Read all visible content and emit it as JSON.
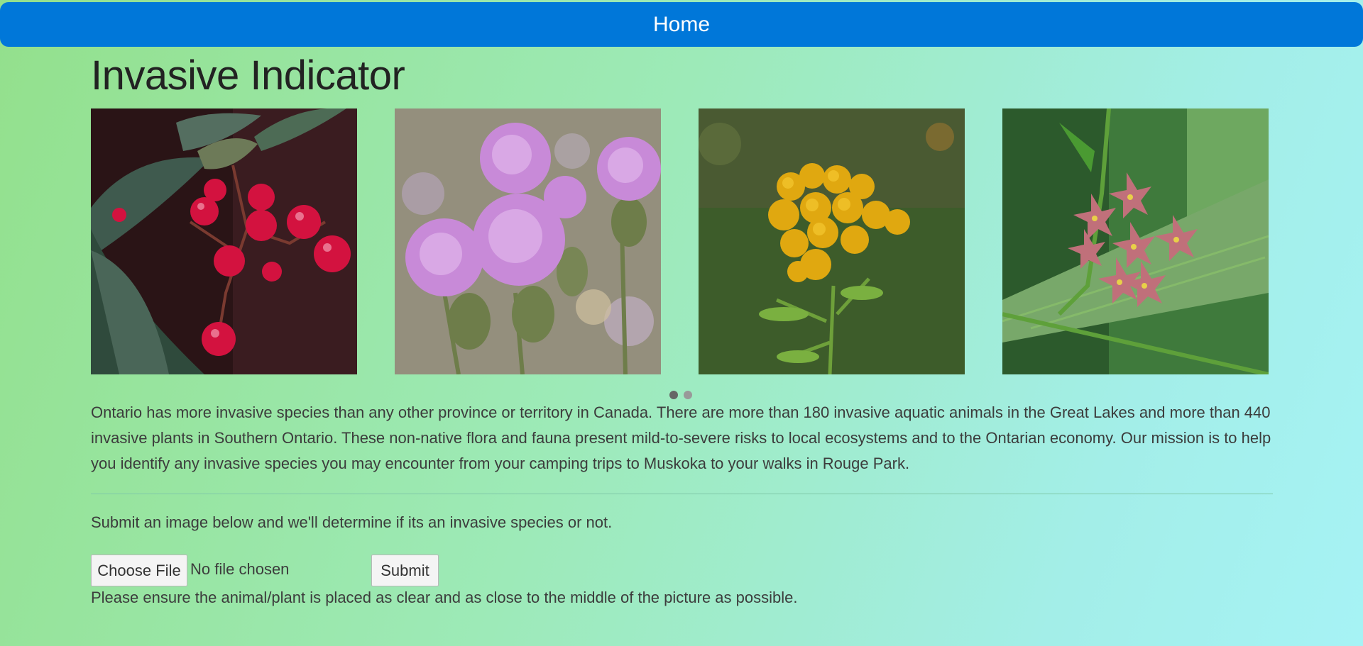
{
  "nav": {
    "home_label": "Home"
  },
  "page": {
    "title": "Invasive Indicator"
  },
  "carousel": {
    "slides": [
      {
        "icon": "red-berries-photo"
      },
      {
        "icon": "purple-thistle-photo"
      },
      {
        "icon": "yellow-tansy-photo"
      },
      {
        "icon": "pink-swallowwort-photo"
      }
    ],
    "active_index": 0,
    "indicator_count": 2
  },
  "intro": {
    "text": "Ontario has more invasive species than any other province or territory in Canada. There are more than 180 invasive aquatic animals in the Great Lakes and more than 440 invasive plants in Southern Ontario. These non-native flora and fauna present mild-to-severe risks to local ecosystems and to the Ontarian economy. Our mission is to help you identify any invasive species you may encounter from your camping trips to Muskoka to your walks in Rouge Park."
  },
  "form": {
    "instruction": "Submit an image below and we'll determine if its an invasive species or not.",
    "choose_file_label": "Choose File",
    "file_status": "No file chosen",
    "submit_label": "Submit",
    "hint": "Please ensure the animal/plant is placed as clear and as close to the middle of the picture as possible."
  },
  "colors": {
    "navbar": "#0077d9",
    "background_start": "#93e08c",
    "background_end": "#a6f3f5"
  }
}
